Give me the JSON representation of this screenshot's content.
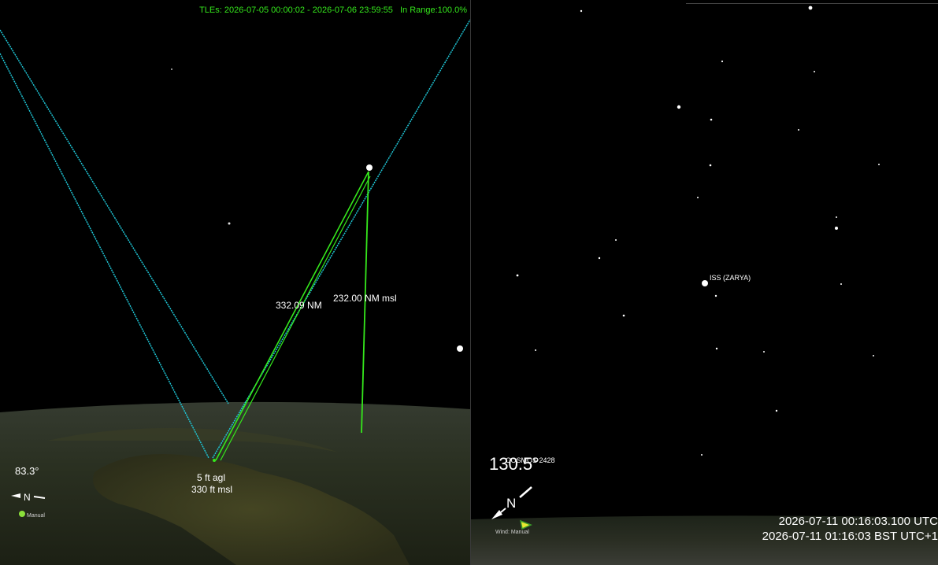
{
  "left_view": {
    "tle_range": "TLEs: 2026-07-05 00:00:02 - 2026-07-06 23:59:55",
    "in_range": "In Range:100.0%",
    "slant_range": "332.09 NM",
    "altitude_msl": "232.00 NM msl",
    "observer_agl": "5 ft agl",
    "observer_msl": "330 ft msl",
    "heading_deg": "83.3°",
    "compass_label": "N",
    "wind_label": "Manual"
  },
  "right_view": {
    "satellite_label": "ISS (ZARYA)",
    "cosmos_label": "COSMOS 2428",
    "heading_deg": "130.5°",
    "compass_label": "N",
    "wind_label": "Wind: Manual",
    "time_utc": "2026-07-11 00:16:03.100 UTC",
    "time_local": "2026-07-11 01:16:03 BST UTC+1"
  },
  "colors": {
    "track_cyan": "#1fc6d6",
    "los_green": "#35e81c",
    "background": "#000000",
    "ground_dark": "#2b3320"
  }
}
